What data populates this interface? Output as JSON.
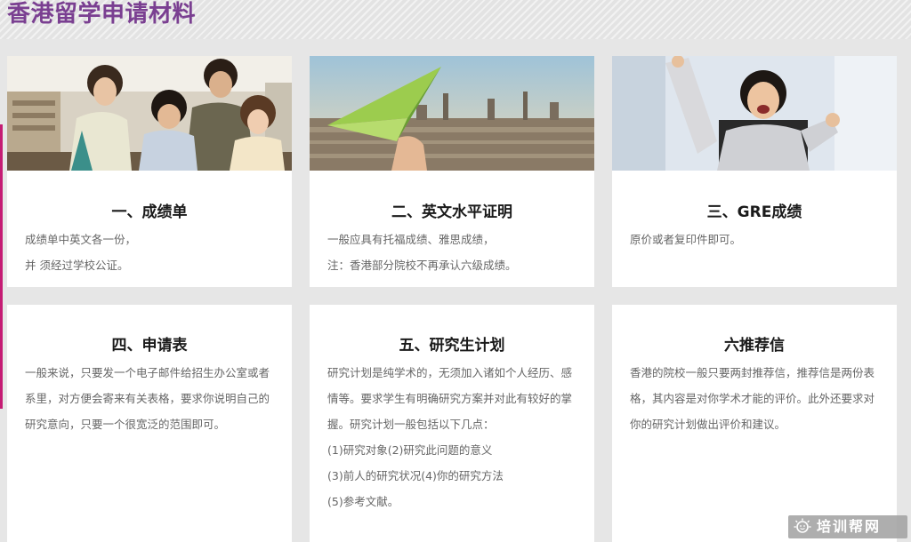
{
  "page": {
    "title": "香港留学申请材料"
  },
  "cards": [
    {
      "title": "一、成绩单",
      "lines": [
        "成绩单中英文各一份，",
        "并 须经过学校公证。"
      ]
    },
    {
      "title": "二、英文水平证明",
      "lines": [
        "一般应具有托福成绩、雅思成绩，",
        "注：香港部分院校不再承认六级成绩。"
      ]
    },
    {
      "title": "三、GRE成绩",
      "lines": [
        "原价或者复印件即可。"
      ]
    },
    {
      "title": "四、申请表",
      "lines": [
        "一般来说，只要发一个电子邮件给招生办公室或者系里，对方便会寄来有关表格，要求你说明自己的研究意向，只要一个很宽泛的范围即可。"
      ]
    },
    {
      "title": "五、研究生计划",
      "lines": [
        "研究计划是纯学术的，无须加入诸如个人经历、感情等。要求学生有明确研究方案并对此有较好的掌握。研究计划一般包括以下几点：",
        "(1)研究对象(2)研究此问题的意义",
        "(3)前人的研究状况(4)你的研究方法",
        "(5)参考文献。"
      ]
    },
    {
      "title": "六推荐信",
      "lines": [
        "香港的院校一般只要两封推荐信，推荐信是两份表格，其内容是对你学术才能的评价。此外还要求对你的研究计划做出评价和建议。"
      ]
    }
  ],
  "watermark": {
    "text": "培训帮网",
    "icon": "smiley-sun-icon"
  },
  "colors": {
    "title": "#7a3f91",
    "accent": "#c51c74",
    "body_text": "#666666"
  }
}
